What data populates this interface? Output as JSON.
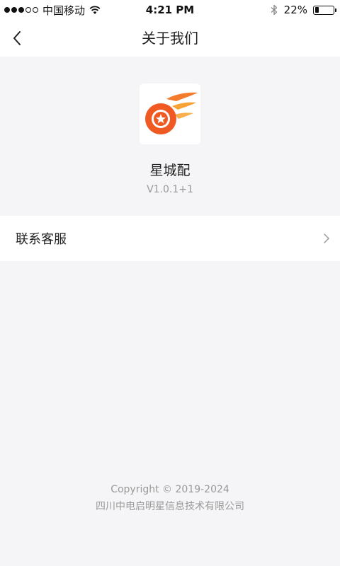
{
  "status_bar": {
    "carrier": "中国移动",
    "time": "4:21 PM",
    "battery_text": "22%",
    "battery_level": 0.22,
    "signal_bars_filled": 3,
    "signal_bars_total": 5,
    "icons": [
      "wifi-icon",
      "bluetooth-icon",
      "battery-icon"
    ]
  },
  "nav": {
    "title": "关于我们",
    "back_icon": "chevron-left-icon"
  },
  "app": {
    "name": "星城配",
    "version": "V1.0.1+1",
    "logo_colors": {
      "primary": "#f05a22",
      "secondary": "#f7a234"
    }
  },
  "menu": {
    "contact_label": "联系客服",
    "chevron_icon": "chevron-right-icon"
  },
  "footer": {
    "copyright": "Copyright  © 2019-2024",
    "company": "四川中电启明星信息技术有限公司"
  }
}
